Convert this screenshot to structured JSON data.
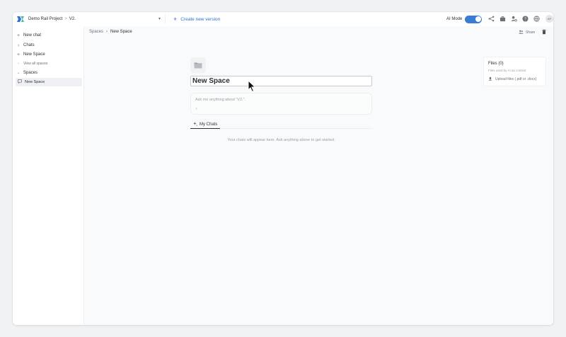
{
  "header": {
    "project_name": "Demo Rail Project",
    "crumb_separator": ">",
    "version": "V2.",
    "create_version_label": "Create new version",
    "ai_mode_label": "AI Mode",
    "avatar_initials": "AP"
  },
  "sidebar": {
    "new_chat": "New chat",
    "chats": "Chats",
    "new_space": "New Space",
    "view_all_spaces": "View all spaces",
    "spaces": "Spaces",
    "active_space": "New Space"
  },
  "main": {
    "breadcrumb": {
      "parent": "Spaces",
      "separator": "›",
      "current": "New Space"
    },
    "share_label": "Share",
    "space_title": "New Space",
    "ask_placeholder": "Ask me anything about \"V2.\".",
    "tab_my_chats": "My Chats",
    "empty_message": "Your chats will appear here. Ask anything above to get started."
  },
  "files": {
    "title": "Files (0)",
    "subtitle": "Files used by AI as context",
    "upload_label": "Upload files (.pdf or .docx)"
  },
  "colors": {
    "accent": "#2f6fd6",
    "toggle_on": "#3a7bd5",
    "text": "#2b2f36",
    "muted": "#9aa0a8",
    "background": "#f1f2f4"
  },
  "icons": [
    "app-logo-icon",
    "chevron-down-icon",
    "plus-icon",
    "share-nodes-icon",
    "briefcase-icon",
    "user-settings-icon",
    "help-icon",
    "globe-icon",
    "folder-icon",
    "chat-icon",
    "trash-icon",
    "upload-icon",
    "paperclip-icon",
    "mouse-cursor-icon"
  ]
}
